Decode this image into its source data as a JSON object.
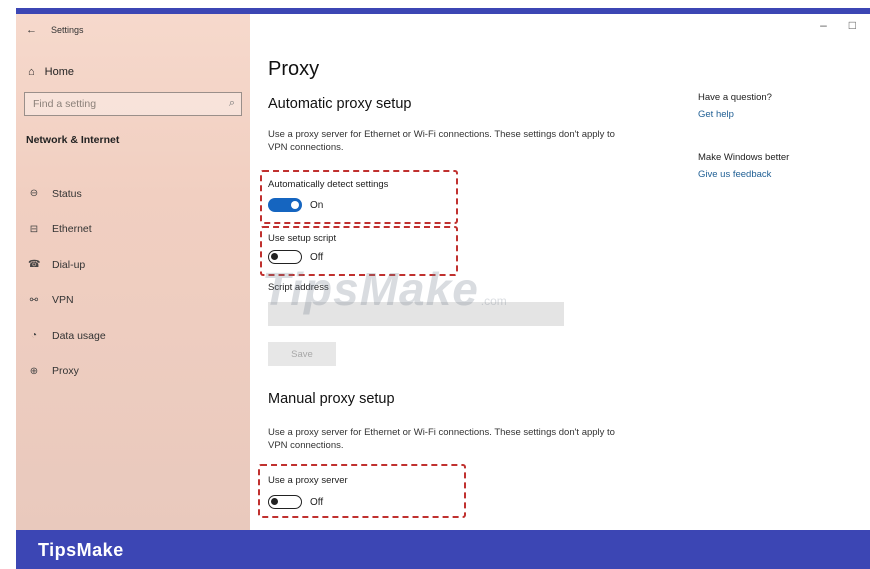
{
  "window": {
    "title": "Settings",
    "minimize": "–",
    "maximize": "□"
  },
  "sidebar": {
    "home": "Home",
    "search_placeholder": "Find a setting",
    "section": "Network & Internet",
    "items": [
      {
        "label": "Status",
        "icon": "⊖"
      },
      {
        "label": "Ethernet",
        "icon": "⊟"
      },
      {
        "label": "Dial-up",
        "icon": "☎"
      },
      {
        "label": "VPN",
        "icon": "⚯"
      },
      {
        "label": "Data usage",
        "icon": "◔"
      },
      {
        "label": "Proxy",
        "icon": "⊕"
      }
    ]
  },
  "main": {
    "title": "Proxy",
    "auto": {
      "heading": "Automatic proxy setup",
      "desc": "Use a proxy server for Ethernet or Wi-Fi connections. These settings don't apply to VPN connections.",
      "detect_label": "Automatically detect settings",
      "detect_state": "On",
      "script_label": "Use setup script",
      "script_state": "Off",
      "address_label": "Script address",
      "save": "Save"
    },
    "manual": {
      "heading": "Manual proxy setup",
      "desc": "Use a proxy server for Ethernet or Wi-Fi connections. These settings don't apply to VPN connections.",
      "proxy_label": "Use a proxy server",
      "proxy_state": "Off"
    }
  },
  "right": {
    "question": "Have a question?",
    "help": "Get help",
    "better": "Make Windows better",
    "feedback": "Give us feedback"
  },
  "watermark": {
    "main": "TipsMake",
    "suffix": ".com"
  },
  "footer": {
    "brand": "TipsMake"
  },
  "colors": {
    "accent": "#3c46b4",
    "toggle_on": "#1565c0",
    "highlight": "#c0312f",
    "link": "#1f5f94"
  }
}
